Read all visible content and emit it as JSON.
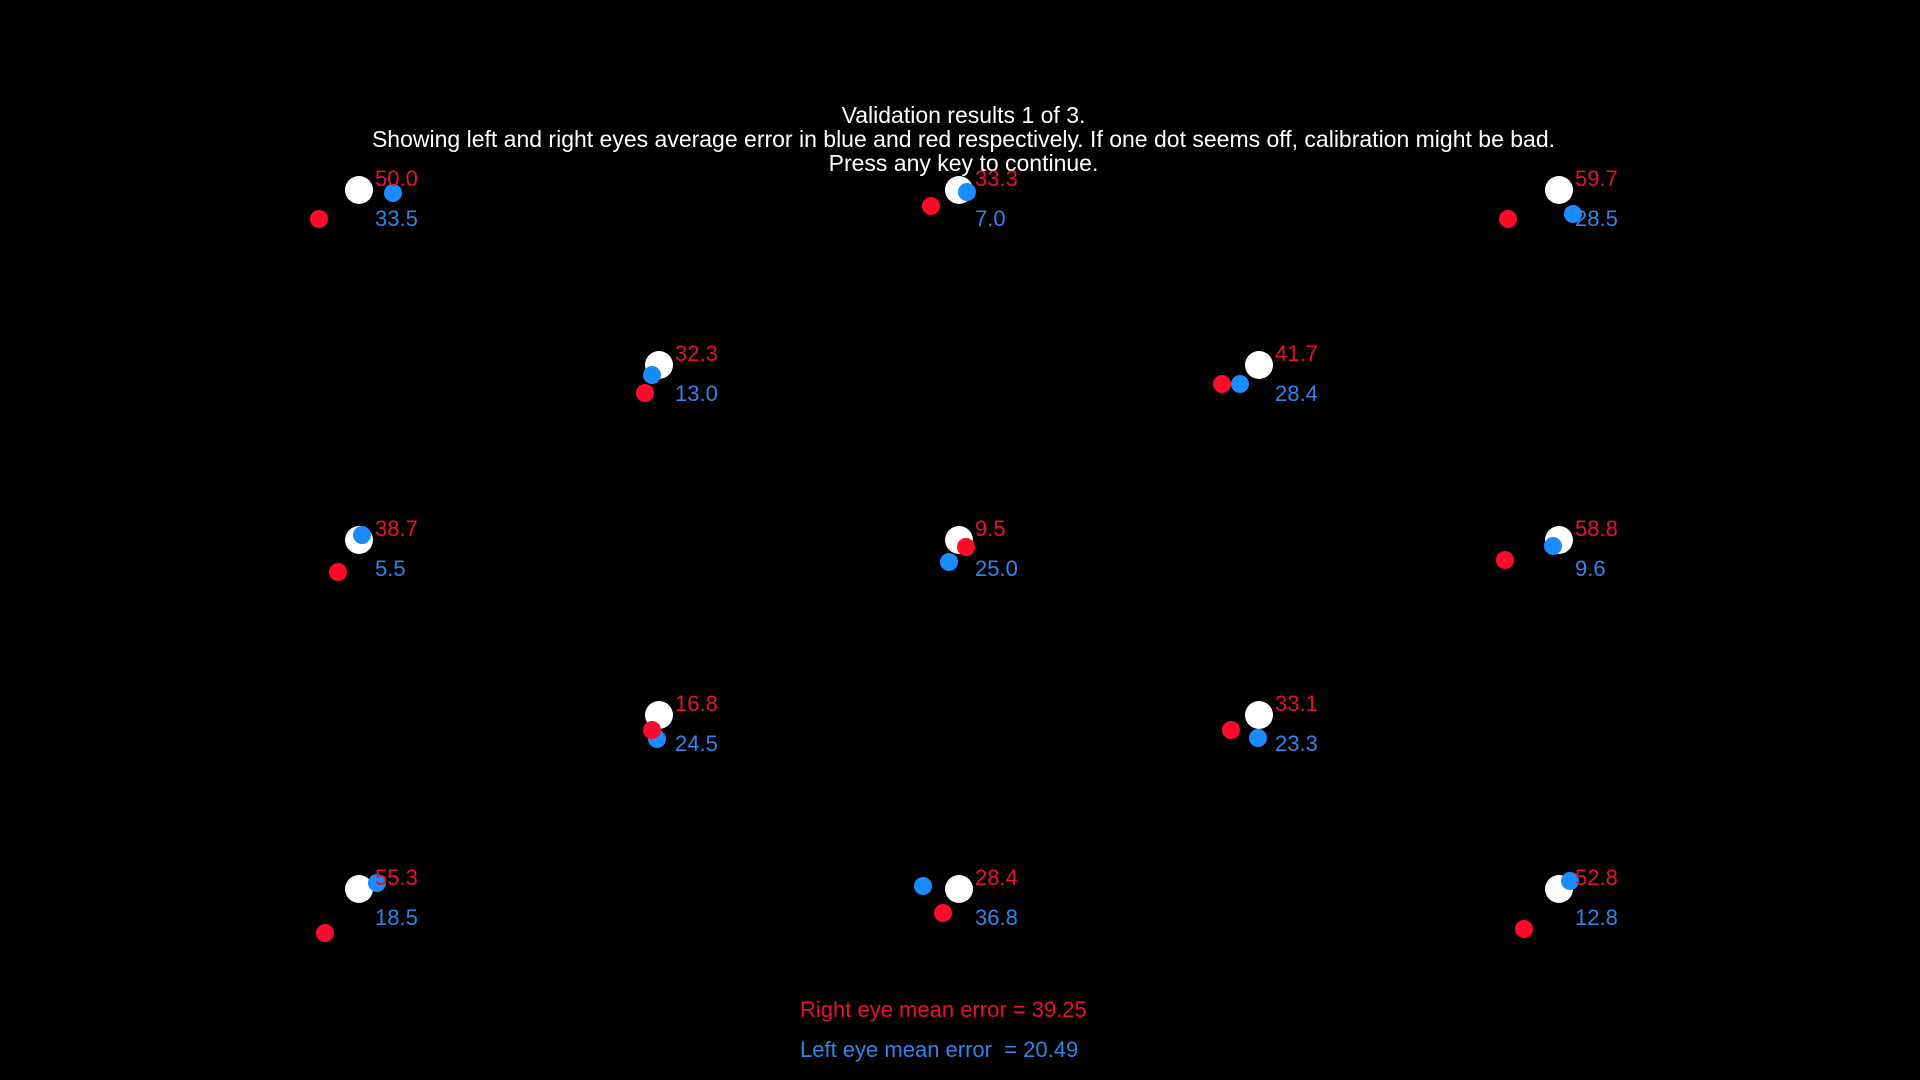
{
  "header": {
    "line1": "Validation results 1 of 3.",
    "line2": "Showing left and right eyes average error in blue and red respectively. If one dot seems off, calibration might be bad.",
    "line3": "Press any key to continue."
  },
  "colors": {
    "background": "#000000",
    "target": "#ffffff",
    "right_eye": "#ff0a2a",
    "left_eye": "#1a8cff",
    "right_text": "#e8112d",
    "left_text": "#2a86e8"
  },
  "points": [
    {
      "right_error": "50.0",
      "left_error": "33.5"
    },
    {
      "right_error": "33.3",
      "left_error": "7.0"
    },
    {
      "right_error": "59.7",
      "left_error": "28.5"
    },
    {
      "right_error": "32.3",
      "left_error": "13.0"
    },
    {
      "right_error": "41.7",
      "left_error": "28.4"
    },
    {
      "right_error": "38.7",
      "left_error": "5.5"
    },
    {
      "right_error": "9.5",
      "left_error": "25.0"
    },
    {
      "right_error": "58.8",
      "left_error": "9.6"
    },
    {
      "right_error": "16.8",
      "left_error": "24.5"
    },
    {
      "right_error": "33.1",
      "left_error": "23.3"
    },
    {
      "right_error": "55.3",
      "left_error": "18.5"
    },
    {
      "right_error": "28.4",
      "left_error": "36.8"
    },
    {
      "right_error": "52.8",
      "left_error": "12.8"
    }
  ],
  "summary": {
    "right": "Right eye mean error = 39.25",
    "left": "Left eye mean error  = 20.49"
  }
}
